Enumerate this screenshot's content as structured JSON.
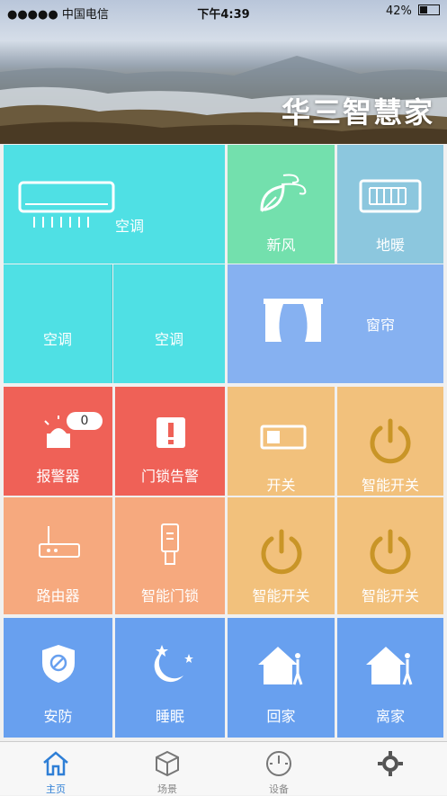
{
  "status_bar": {
    "carrier": "●●●●● 中国电信",
    "time": "下午4:39",
    "battery": "42%"
  },
  "header": {
    "title": "华三智慧家"
  },
  "tiles": {
    "ac_main": "空调",
    "fresh_air": "新风",
    "floor_heating": "地暖",
    "ac_2": "空调",
    "ac_3": "空调",
    "curtain": "窗帘",
    "alarm": "报警器",
    "alarm_badge": "0",
    "door_lock_alarm": "门锁告警",
    "switch": "开关",
    "smart_switch_1": "智能开关",
    "router": "路由器",
    "smart_lock": "智能门锁",
    "smart_switch_2": "智能开关",
    "smart_switch_3": "智能开关",
    "security": "安防",
    "sleep": "睡眠",
    "home": "回家",
    "leave": "离家"
  },
  "tabbar": {
    "items": [
      {
        "label": "主页",
        "icon": "home-icon",
        "active": true
      },
      {
        "label": "场景",
        "icon": "cube-icon",
        "active": false
      },
      {
        "label": "设备",
        "icon": "gauge-icon",
        "active": false
      },
      {
        "label": "",
        "icon": "gear-icon",
        "active": false
      }
    ]
  },
  "colors": {
    "cyan": "#4fe0e4",
    "green": "#73e0ad",
    "blue_gray": "#8cc7de",
    "light_blue": "#86b1f1",
    "red": "#ef6157",
    "orange": "#f2c17c",
    "salmon": "#f6a97e",
    "blue": "#68a0ef",
    "accent": "#2f7fd6",
    "power_icon": "#c99527"
  }
}
